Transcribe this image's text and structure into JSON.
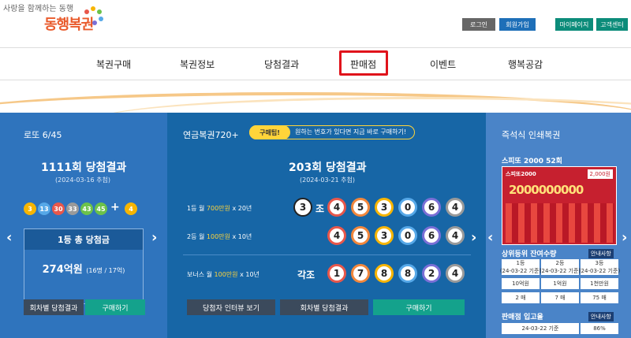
{
  "header": {
    "slogan": "사랑을 함께하는 동행",
    "brand": "동행복권",
    "login": "로그인",
    "join": "회원가입",
    "mypage": "마이페이지",
    "cs": "고객센터"
  },
  "nav": [
    "복권구매",
    "복권정보",
    "당첨결과",
    "판매점",
    "이벤트",
    "행복공감"
  ],
  "lotto": {
    "title": "로또 6/45",
    "round_title": "1111회 당첨결과",
    "date": "(2024-03-16 추첨)",
    "balls": [
      "3",
      "13",
      "30",
      "33",
      "43",
      "45"
    ],
    "ball_colors": [
      "#f7b500",
      "#56a8e8",
      "#e8574b",
      "#9a9a9a",
      "#6cc24a",
      "#6cc24a"
    ],
    "plus": "+",
    "bonus": "4",
    "bonus_color": "#f7b500",
    "prize_head": "1등 총 당첨금",
    "prize_amount": "274억원",
    "prize_detail": "(16명 / 17억)",
    "btn_results": "회차별 당첨결과",
    "btn_buy": "구매하기"
  },
  "pension": {
    "title": "연금복권720+",
    "badge": "구매팁!",
    "tip": "원하는 번호가 있다면 지금 바로 구매하기!",
    "round_title": "203회 당첨결과",
    "date": "(2024-03-21 추첨)",
    "rows": [
      {
        "rank": "1등",
        "prize_pre": "월 ",
        "prize_hl": "700만원",
        "prize_post": " x 20년",
        "group": "3",
        "group_suffix": "조",
        "numbers": [
          "4",
          "5",
          "3",
          "0",
          "6",
          "4"
        ]
      },
      {
        "rank": "2등",
        "prize_pre": "월 ",
        "prize_hl": "100만원",
        "prize_post": " x 10년",
        "group": "",
        "group_suffix": "",
        "numbers": [
          "4",
          "5",
          "3",
          "0",
          "6",
          "4"
        ]
      },
      {
        "rank": "보너스",
        "prize_pre": "월 ",
        "prize_hl": "100만원",
        "prize_post": " x 10년",
        "group": "각조",
        "group_suffix": "",
        "numbers": [
          "1",
          "7",
          "8",
          "8",
          "2",
          "4"
        ]
      }
    ],
    "ring_colors": [
      "#e8574b",
      "#f2873c",
      "#f7b500",
      "#56a8e8",
      "#7a6fd6",
      "#9a9a9a"
    ],
    "btn_interview": "당첨자 인터뷰 보기",
    "btn_results": "회차별 당첨결과",
    "btn_buy": "구매하기"
  },
  "instant": {
    "title": "즉석식 인쇄복권",
    "product": "스피또 2000 52회",
    "ticket_label": "스피또2000",
    "ticket_big": "2000000000",
    "ticket_price": "2,000원",
    "remain_title": "상위등위 잔여수량",
    "remain_badge": "안내사항",
    "remain_cols": [
      {
        "rank": "1등",
        "date": "(24-03-22 기준)",
        "prize": "10억원",
        "count": "2 매"
      },
      {
        "rank": "2등",
        "date": "(24-03-22 기준)",
        "prize": "1억원",
        "count": "7 매"
      },
      {
        "rank": "3등",
        "date": "(24-03-22 기준)",
        "prize": "1천만원",
        "count": "75 매"
      }
    ],
    "stock_title": "판매점 입고율",
    "stock_badge": "안내사항",
    "stock_date": "24-03-22 기준",
    "stock_rate": "86%"
  }
}
